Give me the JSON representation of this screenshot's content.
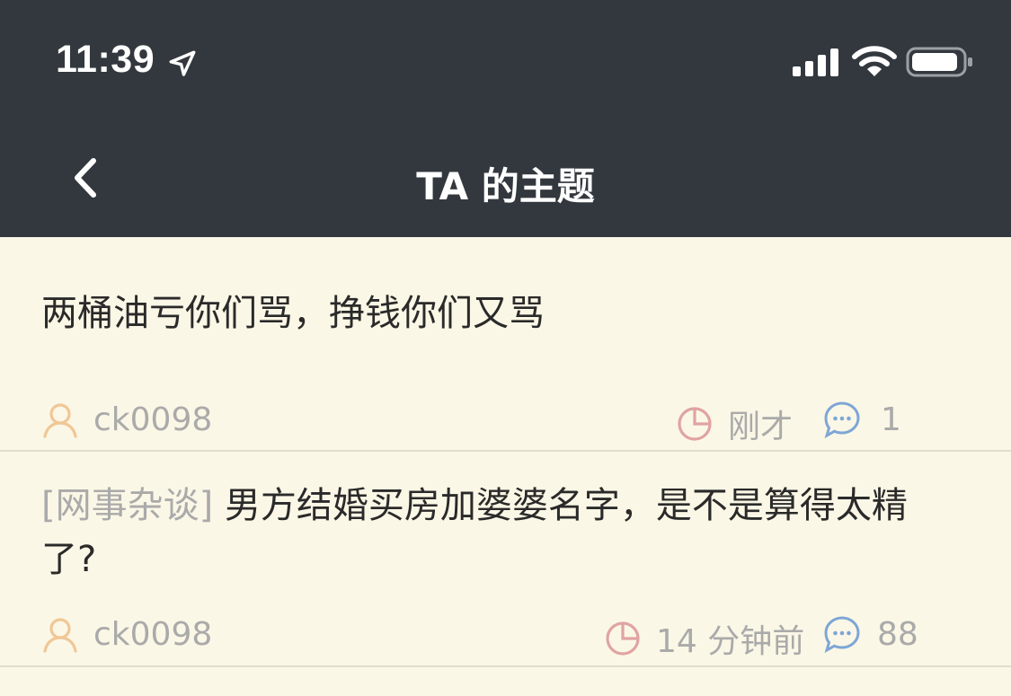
{
  "status_bar": {
    "time": "11:39"
  },
  "nav": {
    "back_icon": "chevron-left-icon",
    "title": "TA 的主题"
  },
  "colors": {
    "top_bar": "#32383d",
    "list_background": "#fbf7e6",
    "user_icon": "#f0c796",
    "time_icon": "#e0a3a3",
    "comment_icon": "#7ea6d6",
    "meta_text": "#aaaaaa"
  },
  "topics": [
    {
      "category": "",
      "title": "两桶油亏你们骂，挣钱你们又骂",
      "author": "ck0098",
      "time": "刚才",
      "replies": "1"
    },
    {
      "category": "[网事杂谈]",
      "title": "男方结婚买房加婆婆名字，是不是算得太精了?",
      "author": "ck0098",
      "time": "14 分钟前",
      "replies": "88"
    }
  ]
}
